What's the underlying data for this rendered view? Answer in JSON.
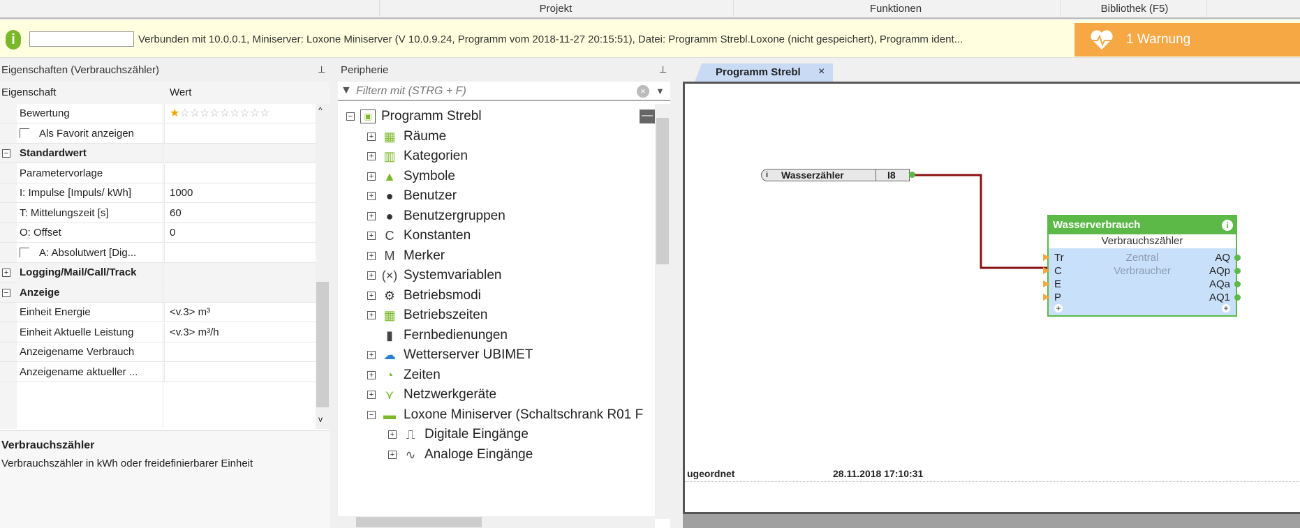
{
  "menu": {
    "items": [
      "Projekt",
      "Funktionen",
      "Bibliothek (F5)"
    ]
  },
  "infobar": {
    "status_text": "Verbunden mit 10.0.0.1, Miniserver: Loxone Miniserver (V 10.0.9.24, Programm vom 2018-11-27 20:15:51), Datei: Programm Strebl.Loxone (nicht gespeichert), Programm ident...",
    "input_value": "",
    "warning_label": "1 Warnung",
    "warning_color": "#f6a845"
  },
  "properties": {
    "title": "Eigenschaften (Verbrauchszähler)",
    "col_property": "Eigenschaft",
    "col_value": "Wert",
    "rows": [
      {
        "label": "Bewertung",
        "value": "",
        "rating": 1,
        "rating_max": 10
      },
      {
        "label": "Als Favorit anzeigen",
        "value": "",
        "checkbox": false
      },
      {
        "label": "Standardwert",
        "category": true,
        "expanded": true
      },
      {
        "label": "Parametervorlage",
        "value": ""
      },
      {
        "label": "I: Impulse [Impuls/ kWh]",
        "value": "1000"
      },
      {
        "label": "T: Mittelungszeit [s]",
        "value": "60"
      },
      {
        "label": "O: Offset",
        "value": "0"
      },
      {
        "label": "A: Absolutwert [Dig...",
        "value": "",
        "checkbox": false
      },
      {
        "label": "Logging/Mail/Call/Track",
        "category": true,
        "expanded": false
      },
      {
        "label": "Anzeige",
        "category": true,
        "expanded": true
      },
      {
        "label": "Einheit Energie",
        "value": "<v.3> m³"
      },
      {
        "label": "Einheit Aktuelle Leistung",
        "value": "<v.3> m³/h"
      },
      {
        "label": "Anzeigename Verbrauch",
        "value": ""
      },
      {
        "label": "Anzeigename aktueller ...",
        "value": ""
      }
    ],
    "desc_title": "Verbrauchszähler",
    "desc_text": "Verbrauchszähler in kWh oder freidefinierbarer Einheit"
  },
  "periphery": {
    "title": "Peripherie",
    "filter_placeholder": "Filtern mit (STRG + F)",
    "root": "Programm Strebl",
    "items": [
      {
        "label": "Räume",
        "icon": "rooms-icon"
      },
      {
        "label": "Kategorien",
        "icon": "categories-icon"
      },
      {
        "label": "Symbole",
        "icon": "symbols-icon"
      },
      {
        "label": "Benutzer",
        "icon": "user-icon"
      },
      {
        "label": "Benutzergruppen",
        "icon": "user-group-icon"
      },
      {
        "label": "Konstanten",
        "icon": "constant-icon"
      },
      {
        "label": "Merker",
        "icon": "marker-icon"
      },
      {
        "label": "Systemvariablen",
        "icon": "system-variable-icon"
      },
      {
        "label": "Betriebsmodi",
        "icon": "gear-icon"
      },
      {
        "label": "Betriebszeiten",
        "icon": "calendar-icon"
      },
      {
        "label": "Fernbedienungen",
        "icon": "remote-icon"
      },
      {
        "label": "Wetterserver UBIMET",
        "icon": "weather-icon"
      },
      {
        "label": "Zeiten",
        "icon": "clock-icon"
      },
      {
        "label": "Netzwerkgeräte",
        "icon": "network-icon"
      },
      {
        "label": "Loxone Miniserver (Schaltschrank R01 F",
        "icon": "miniserver-icon"
      }
    ],
    "subitems": [
      {
        "label": "Digitale Eingänge",
        "icon": "digital-input-icon"
      },
      {
        "label": "Analoge Eingänge",
        "icon": "analog-input-icon"
      }
    ]
  },
  "editor": {
    "tab_label": "Programm Strebl",
    "input_block": {
      "name": "Wasserzähler",
      "port": "I8"
    },
    "function_block": {
      "title": "Wasserverbrauch",
      "type": "Verbrauchszähler",
      "center_lines": [
        "Zentral",
        "Verbraucher"
      ],
      "inputs": [
        "Tr",
        "C",
        "E",
        "P"
      ],
      "outputs": [
        "AQ",
        "AQp",
        "AQa",
        "AQ1"
      ],
      "header_color": "#5cb947"
    },
    "wire_color": "#8b1010",
    "status_left": "ugeordnet",
    "status_date": "28.11.2018 17:10:31"
  }
}
